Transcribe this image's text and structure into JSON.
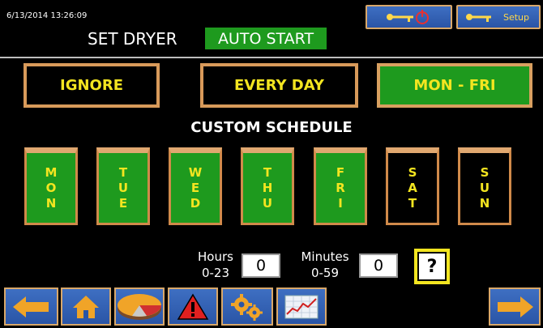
{
  "header": {
    "datetime": "6/13/2014 13:26:09",
    "title": "SET DRYER",
    "auto_start": "AUTO START",
    "setup_label": "Setup"
  },
  "modes": {
    "ignore": "IGNORE",
    "every_day": "EVERY DAY",
    "mon_fri": "MON - FRI",
    "selected": "MON - FRI"
  },
  "custom_schedule": {
    "title": "CUSTOM SCHEDULE",
    "days": [
      {
        "letters": [
          "M",
          "O",
          "N"
        ],
        "active": true
      },
      {
        "letters": [
          "T",
          "U",
          "E"
        ],
        "active": true
      },
      {
        "letters": [
          "W",
          "E",
          "D"
        ],
        "active": true
      },
      {
        "letters": [
          "T",
          "H",
          "U"
        ],
        "active": true
      },
      {
        "letters": [
          "F",
          "R",
          "I"
        ],
        "active": true
      },
      {
        "letters": [
          "S",
          "A",
          "T"
        ],
        "active": false
      },
      {
        "letters": [
          "S",
          "U",
          "N"
        ],
        "active": false
      }
    ]
  },
  "time": {
    "hours_label": "Hours",
    "hours_range": "0-23",
    "hours_value": "0",
    "minutes_label": "Minutes",
    "minutes_range": "0-59",
    "minutes_value": "0",
    "help": "?"
  },
  "nav_icons": [
    "back-arrow-icon",
    "home-icon",
    "pie-chart-icon",
    "alarm-warning-icon",
    "gears-icon",
    "trend-graph-icon",
    "forward-arrow-icon"
  ],
  "colors": {
    "active_green": "#1e9a1e",
    "text_yellow": "#f3e520",
    "button_blue": "#2a55a6",
    "border_orange": "#d89a5a"
  }
}
